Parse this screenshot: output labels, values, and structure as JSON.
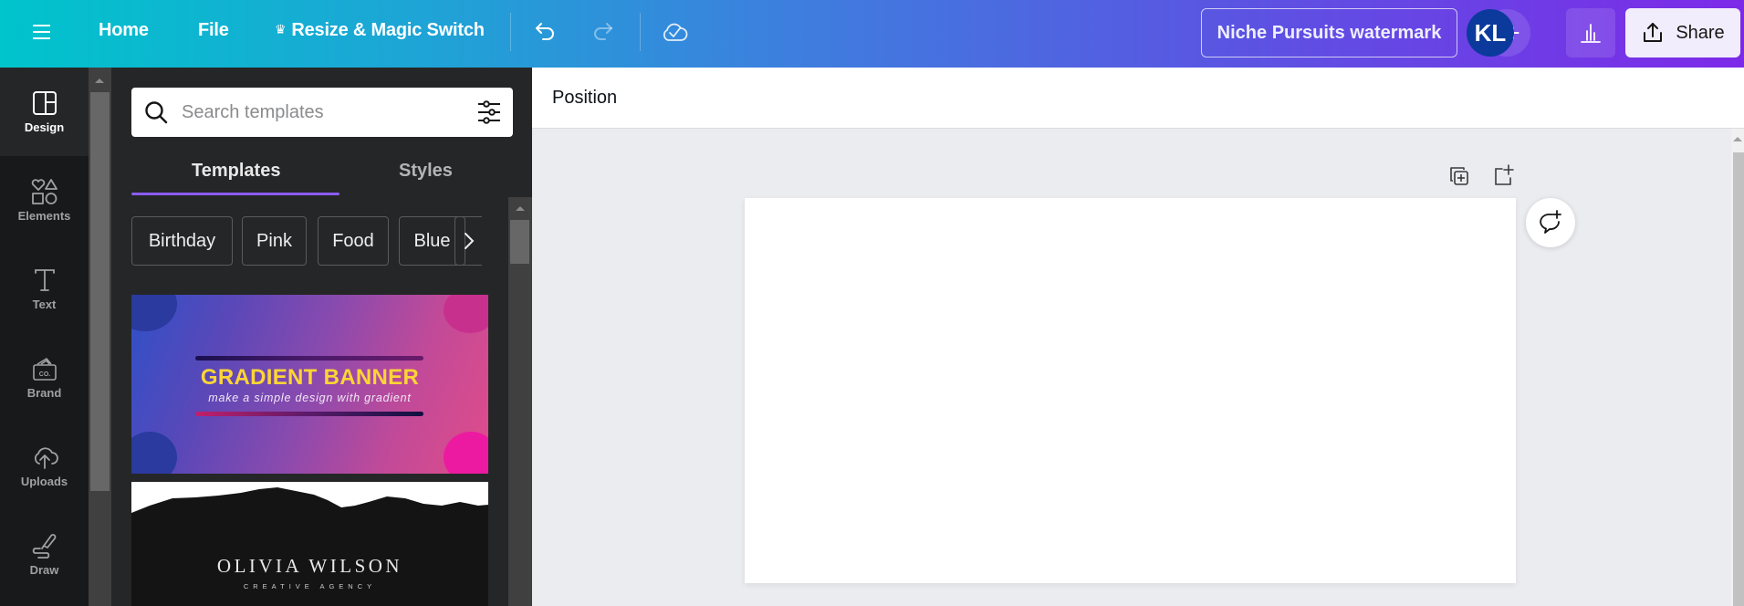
{
  "topbar": {
    "menu_icon": "hamburger-menu-icon",
    "home_label": "Home",
    "file_label": "File",
    "resize_label": "Resize & Magic Switch",
    "resize_icon": "crown-icon",
    "undo_icon": "undo-icon",
    "redo_icon": "redo-icon",
    "save_status_icon": "cloud-check-icon",
    "document_title": "Niche Pursuits watermark",
    "avatar_initials": "KL",
    "add_collaborator_label": "+",
    "insights_icon": "bar-chart-icon",
    "share_label": "Share",
    "share_icon": "upload-share-icon"
  },
  "rail": {
    "items": [
      {
        "label": "Design",
        "icon": "design-layout-icon",
        "active": true
      },
      {
        "label": "Elements",
        "icon": "shapes-icon",
        "active": false
      },
      {
        "label": "Text",
        "icon": "text-icon",
        "active": false
      },
      {
        "label": "Brand",
        "icon": "brand-kit-icon",
        "active": false,
        "icon_text": "CO."
      },
      {
        "label": "Uploads",
        "icon": "cloud-upload-icon",
        "active": false
      },
      {
        "label": "Draw",
        "icon": "draw-pen-icon",
        "active": false
      }
    ]
  },
  "panel": {
    "search": {
      "placeholder": "Search templates",
      "value": ""
    },
    "tabs": [
      {
        "label": "Templates",
        "active": true
      },
      {
        "label": "Styles",
        "active": false
      }
    ],
    "chips": [
      "Birthday",
      "Pink",
      "Food",
      "Blue"
    ],
    "templates": [
      {
        "title": "GRADIENT BANNER",
        "subtitle": "make a simple design with gradient"
      },
      {
        "title": "OLIVIA WILSON",
        "subtitle": "CREATIVE AGENCY"
      }
    ]
  },
  "context_bar": {
    "position_label": "Position"
  },
  "canvas": {
    "duplicate_page_icon": "duplicate-page-icon",
    "add_page_icon": "add-page-icon",
    "add_comment_icon": "add-comment-icon"
  },
  "colors": {
    "topbar_gradient_start": "#00c4cc",
    "topbar_gradient_end": "#7d2ae8",
    "active_tab_underline": "#8b5cf6",
    "avatar_bg": "#0b3a9c",
    "gradient_banner_title": "#fcd535"
  }
}
